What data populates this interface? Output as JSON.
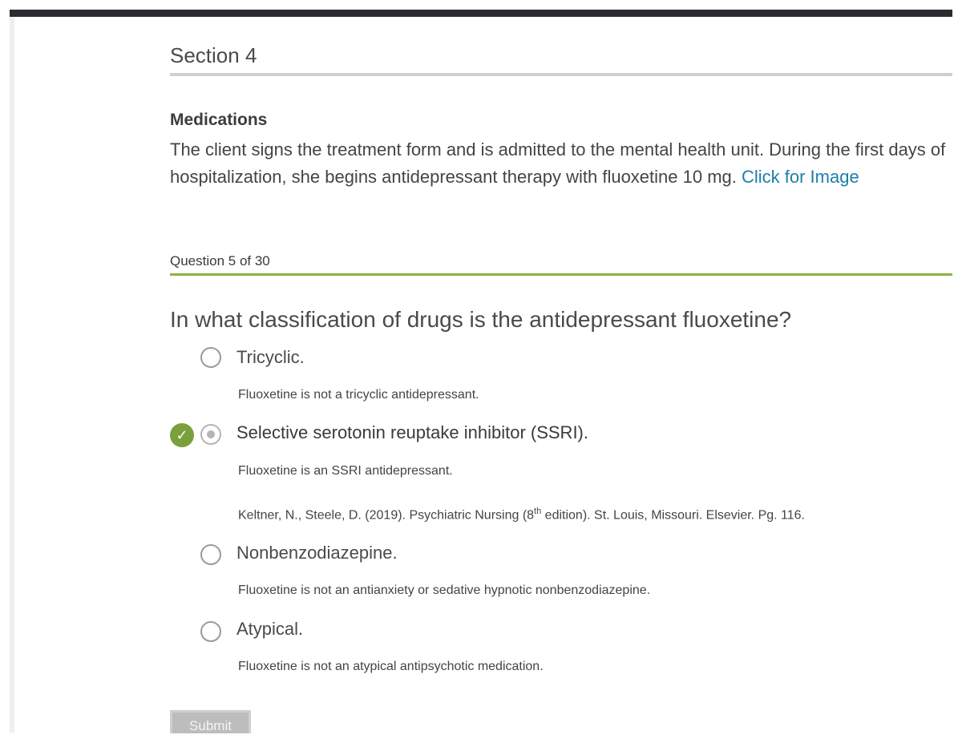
{
  "section": {
    "title": "Section 4"
  },
  "scenario": {
    "title": "Medications",
    "text": "The client signs the treatment form and is admitted to the mental health unit. During the first days of hospitalization, she begins antidepressant therapy with fluoxetine 10 mg. ",
    "link": "Click for Image"
  },
  "counter": "Question 5 of 30",
  "question": "In what classification of drugs is the antidepressant fluoxetine?",
  "options": [
    {
      "label": "Tricyclic.",
      "selected": false,
      "rationale": "Fluoxetine is not a tricyclic antidepressant."
    },
    {
      "label": "Selective serotonin reuptake inhibitor (SSRI).",
      "selected": true,
      "correct": true,
      "rationale": "Fluoxetine is an SSRI antidepressant.",
      "reference": {
        "before": "Keltner, N., Steele, D. (2019). Psychiatric Nursing (8",
        "sup": "th",
        "after": " edition). St. Louis, Missouri. Elsevier. Pg. 116."
      }
    },
    {
      "label": "Nonbenzodiazepine.",
      "selected": false,
      "rationale": "Fluoxetine is not an antianxiety or sedative hypnotic nonbenzodiazepine."
    },
    {
      "label": "Atypical.",
      "selected": false,
      "rationale": "Fluoxetine is not an atypical antipsychotic medication."
    }
  ],
  "submit_label": "Submit",
  "colors": {
    "accent_green": "#7aa03c",
    "link_blue": "#1f7ea8",
    "topbar": "#2b2b31"
  },
  "icons": {
    "correct": "checkmark-icon"
  }
}
